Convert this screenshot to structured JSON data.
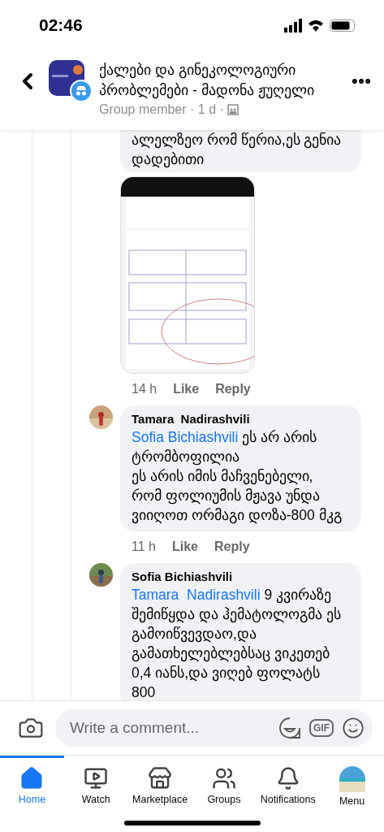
{
  "status_bar": {
    "time": "02:46"
  },
  "header": {
    "title": "ქალები და გინეკოლოგიური პრობლემები - მადონა ჟუღელი",
    "subtitle": "Group member · 1 d ·"
  },
  "comments": [
    {
      "kind": "cut",
      "text": "ალელზეო რომ წერია,ეს გენია დადებითი",
      "attachment": {
        "kind": "picture"
      },
      "time": "14 h",
      "actions": [
        "Like",
        "Reply"
      ]
    },
    {
      "kind": "reply",
      "author": "Tamara  Nadirashvili",
      "mention": "Sofia Bichiashvili",
      "text": " ეს არ არის ტრომბოფილია\nეს არის იმის მაჩვენებელი, რომ ფოლიუმის მჟავა უნდა ვიიღოთ ორმაგი დოზა-800 მკგ",
      "time": "11 h",
      "actions": [
        "Like",
        "Reply"
      ]
    },
    {
      "kind": "reply",
      "author": "Sofia Bichiashvili",
      "mention": "Tamara  Nadirashvili",
      "text": " 9 კვირაზე შემიწყდა და ჰემატოლოგმა ეს გამოიწვევდაო,და გამათხელებლებსაც ვიკეთებ 0,4 იანს,და ვიღებ ფოლატს 800"
    }
  ],
  "composer": {
    "placeholder": "Write a comment...",
    "gif_label": "GIF"
  },
  "tabs": [
    {
      "kind": "home",
      "label": "Home",
      "selected": true
    },
    {
      "kind": "watch",
      "label": "Watch",
      "selected": false
    },
    {
      "kind": "marketplace",
      "label": "Marketplace",
      "selected": false
    },
    {
      "kind": "groups",
      "label": "Groups",
      "selected": false
    },
    {
      "kind": "notifications",
      "label": "Notifications",
      "selected": false
    },
    {
      "kind": "menu",
      "label": "Menu",
      "selected": false
    }
  ]
}
